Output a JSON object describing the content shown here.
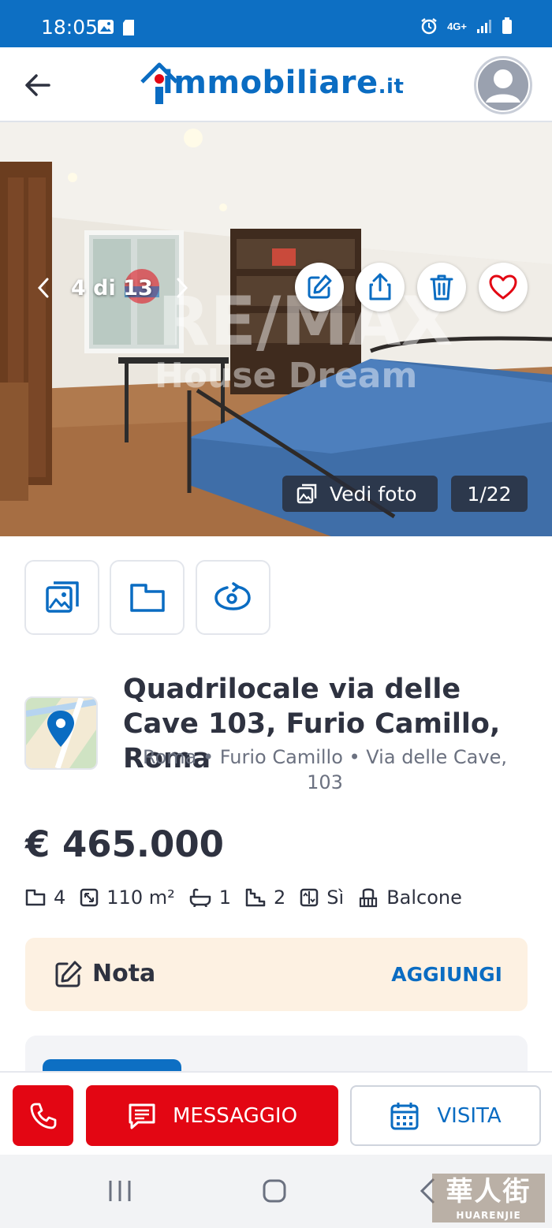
{
  "status_bar": {
    "time": "18:05",
    "network": "4G+"
  },
  "header": {
    "logo_main": "immobiliare",
    "logo_tld": ".it"
  },
  "gallery": {
    "position_label": "4 di 13",
    "vedi_foto_label": "Vedi foto",
    "photo_count": "1/22",
    "watermark_brand": "RE/MAX",
    "watermark_agency": "House Dream"
  },
  "listing": {
    "title": "Quadrilocale via delle Cave 103, Furio Camillo, Roma",
    "location": "Roma • Furio Camillo • Via delle Cave, 103",
    "price": "€ 465.000",
    "features": {
      "rooms": "4",
      "surface": "110 m²",
      "bathrooms": "1",
      "floor": "2",
      "elevator": "Sì",
      "balcony": "Balcone"
    }
  },
  "note": {
    "label": "Nota",
    "action": "AGGIUNGI"
  },
  "actions": {
    "message": "MESSAGGIO",
    "visit": "VISITA"
  },
  "watermark_corner": {
    "text": "華人街",
    "sub": "HUARENJIE"
  },
  "colors": {
    "brand_blue": "#0a6cc2",
    "cta_red": "#e30613",
    "note_bg": "#fdf1e2"
  }
}
